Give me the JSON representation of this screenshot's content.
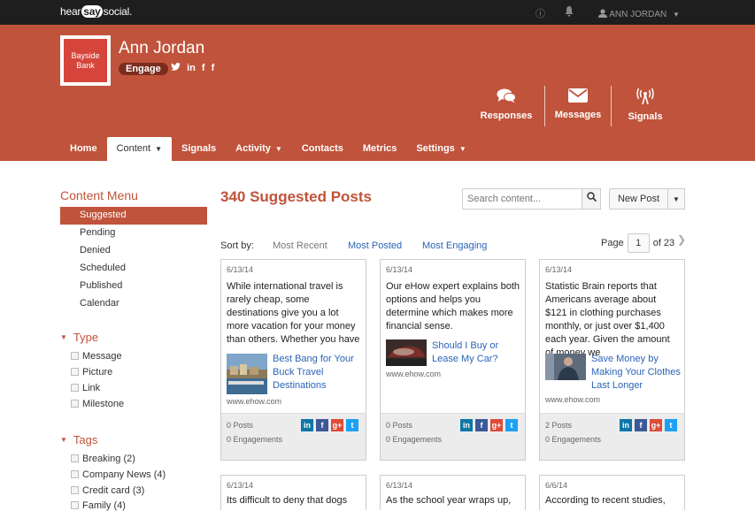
{
  "topbar": {
    "logo_pre": "hear",
    "logo_say": "say",
    "logo_post": "social.",
    "user": "ANN JORDAN"
  },
  "profile": {
    "name": "Ann Jordan",
    "brand": "Bayside Bank",
    "engage": "Engage",
    "social_icons": [
      "twitter-icon",
      "linkedin-icon",
      "facebook-icon",
      "facebook-icon"
    ]
  },
  "actions": [
    {
      "label": "Responses",
      "icon": "chat-icon"
    },
    {
      "label": "Messages",
      "icon": "envelope-icon"
    },
    {
      "label": "Signals",
      "icon": "antenna-icon"
    }
  ],
  "nav": [
    {
      "label": "Home"
    },
    {
      "label": "Content"
    },
    {
      "label": "Signals"
    },
    {
      "label": "Activity"
    },
    {
      "label": "Contacts"
    },
    {
      "label": "Metrics"
    },
    {
      "label": "Settings"
    }
  ],
  "sidebar": {
    "title": "Content Menu",
    "items": [
      "Suggested",
      "Pending",
      "Denied",
      "Scheduled",
      "Published",
      "Calendar"
    ],
    "type_title": "Type",
    "types": [
      "Message",
      "Picture",
      "Link",
      "Milestone"
    ],
    "tags_title": "Tags",
    "tags": [
      {
        "label": "Breaking",
        "count": "(2)"
      },
      {
        "label": "Company News",
        "count": "(4)"
      },
      {
        "label": "Credit card",
        "count": "(3)"
      },
      {
        "label": "Family",
        "count": "(4)"
      }
    ]
  },
  "main": {
    "title": "340 Suggested Posts",
    "search_placeholder": "Search content...",
    "new_post": "New Post",
    "sort_label": "Sort by:",
    "sort_options": [
      "Most Recent",
      "Most Posted",
      "Most Engaging"
    ],
    "page_label": "Page",
    "page_current": "1",
    "page_total": "of 23"
  },
  "cards": [
    {
      "date": "6/13/14",
      "body": "While international travel is rarely cheap, some destinations give you a lot more vacation for your money than others. Whether you have",
      "link_title": "Best Bang for Your Buck Travel Destinations",
      "domain": "www.ehow.com",
      "posts": "0 Posts",
      "engagements": "0 Engagements"
    },
    {
      "date": "6/13/14",
      "body": "Our eHow expert explains both options and helps you determine which makes more financial sense.",
      "link_title": "Should I Buy or Lease My Car?",
      "domain": "www.ehow.com",
      "posts": "0 Posts",
      "engagements": "0 Engagements"
    },
    {
      "date": "6/13/14",
      "body": "Statistic Brain reports that Americans average about $121 in clothing purchases monthly, or just over $1,400 each year. Given the amount of money we",
      "link_title": "Save Money by Making Your Clothes Last Longer",
      "domain": "www.ehow.com",
      "posts": "2 Posts",
      "engagements": "0 Engagements"
    }
  ],
  "cards_row2": [
    {
      "date": "6/13/14",
      "body": "Its difficult to deny that dogs"
    },
    {
      "date": "6/13/14",
      "body": "As the school year wraps up,"
    },
    {
      "date": "6/6/14",
      "body": "According to recent studies,"
    }
  ],
  "share_labels": [
    "in",
    "f",
    "g+",
    "t"
  ],
  "colors": {
    "accent": "#c0533b",
    "link": "#2a64b8",
    "linkedin": "#0e76a8",
    "facebook": "#3b5998",
    "google": "#dd4b39",
    "twitter": "#1da1f2"
  }
}
